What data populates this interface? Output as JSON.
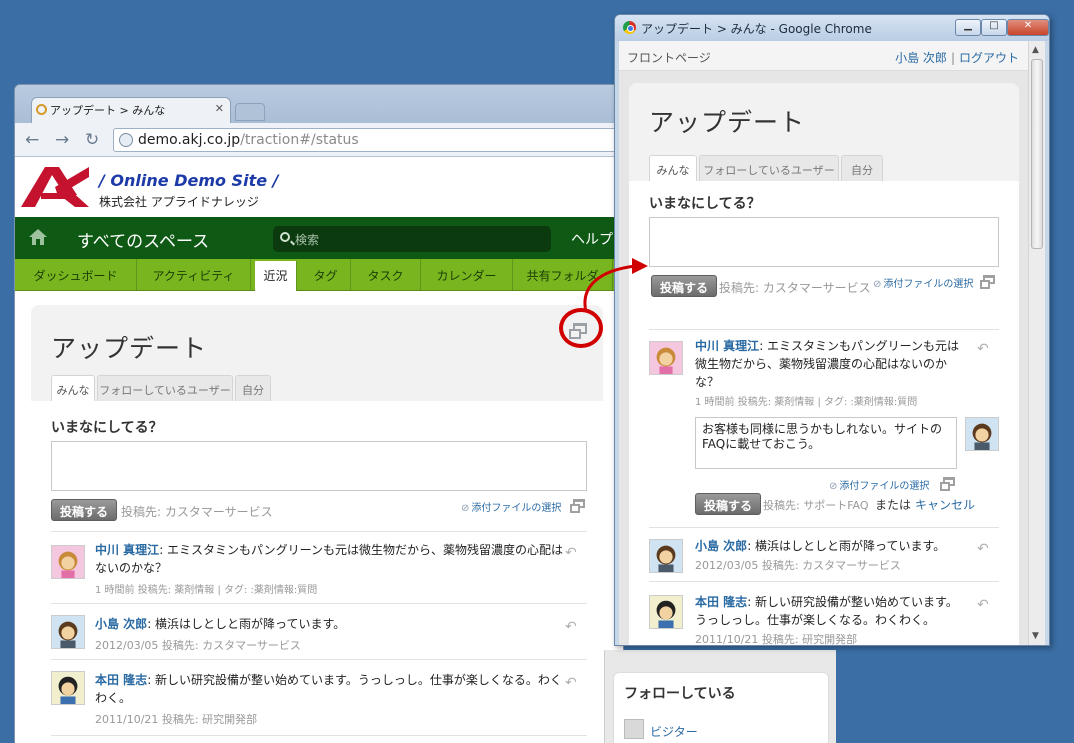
{
  "main_window": {
    "tab_title": "アップデート > みんな",
    "url_host": "demo.akj.co.jp",
    "url_path": "/traction#/status"
  },
  "site": {
    "logo_text": "A",
    "title": "/ Online Demo Site /",
    "company": "株式会社 アプライドナレッジ",
    "space_title": "すべてのスペース",
    "search_placeholder": "検索",
    "help": "ヘルプ",
    "nav": [
      "ダッシュボード",
      "アクティビティ",
      "近況",
      "タグ",
      "タスク",
      "カレンダー",
      "共有フォルダ"
    ],
    "nav_active": "近況"
  },
  "updates": {
    "title": "アップデート",
    "tabs": [
      "みんな",
      "フォローしているユーザー",
      "自分"
    ],
    "prompt": "いまなにしてる？",
    "post_button": "投稿する",
    "post_to": "投稿先: カスタマーサービス",
    "attach": "添付ファイルの選択",
    "posts": [
      {
        "author": "中川 真理江",
        "text": ": エミスタミンもパングリーンも元は微生物だから、薬物残留濃度の心配はないのかな？",
        "meta": "1 時間前 投稿先: 薬剤情報 | タグ: :薬剤情報:質問"
      },
      {
        "author": "小島 次郎",
        "text": ": 横浜はしとしと雨が降っています。",
        "meta": "2012/03/05 投稿先: カスタマーサービス"
      },
      {
        "author": "本田 隆志",
        "text": ": 新しい研究設備が整い始めています。うっしっし。仕事が楽しくなる。わくわく。",
        "meta": "2011/10/21 投稿先: 研究開発部"
      }
    ]
  },
  "sidebar": {
    "title": "フォローしている",
    "user": "ビジター"
  },
  "popup": {
    "window_title": "アップデート > みんな - Google Chrome",
    "front_page": "フロントページ",
    "user_name": "小島 次郎",
    "logout": "ログアウト",
    "separator": "|",
    "title": "アップデート",
    "tabs": [
      "みんな",
      "フォローしているユーザー",
      "自分"
    ],
    "prompt": "いまなにしてる？",
    "post_button": "投稿する",
    "post_to": "投稿先: カスタマーサービス",
    "attach": "添付ファイルの選択",
    "posts": [
      {
        "author": "中川 真理江",
        "text_l1": ": エミスタミンもパングリーンも元は",
        "text_l2": "微生物だから、薬物残留濃度の心配はないのか",
        "text_l3": "な？",
        "meta": "1 時間前 投稿先: 薬剤情報 | タグ: :薬剤情報:質問"
      },
      {
        "author": "小島 次郎",
        "text": ": 横浜はしとしと雨が降っています。",
        "meta": "2012/03/05 投稿先: カスタマーサービス"
      },
      {
        "author": "本田 隆志",
        "text_l1": ": 新しい研究設備が整い始めています。",
        "text_l2": "うっしっし。仕事が楽しくなる。わくわく。",
        "meta": "2011/10/21 投稿先: 研究開発部"
      }
    ],
    "reply_box": {
      "text_l1": "お客様も同様に思うかもしれない。サイトの",
      "text_l2": "FAQに載せておこう。",
      "attach": "添付ファイルの選択",
      "post_button": "投稿する",
      "post_to": "投稿先: サポートFAQ",
      "or": "または",
      "cancel": "キャンセル"
    }
  },
  "colors": {
    "desktop": "#3a6ea5",
    "site_green": "#0e5a14",
    "nav_green": "#78b51f",
    "link_blue": "#2a6aa3",
    "annotation_red": "#d00000"
  }
}
